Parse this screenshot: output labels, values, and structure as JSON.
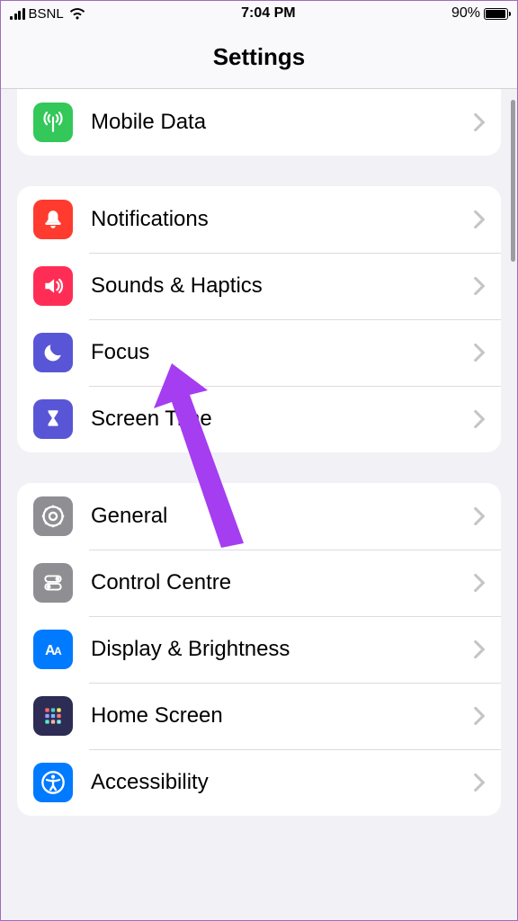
{
  "status": {
    "carrier": "BSNL",
    "time": "7:04 PM",
    "battery_pct": "90%",
    "battery_fill_pct": 90
  },
  "nav": {
    "title": "Settings"
  },
  "groups": [
    {
      "id": "connectivity",
      "rows": [
        {
          "id": "mobile-data",
          "label": "Mobile Data",
          "icon": "antenna-icon",
          "bg": "bg-green"
        }
      ]
    },
    {
      "id": "notifications",
      "rows": [
        {
          "id": "notifications",
          "label": "Notifications",
          "icon": "bell-icon",
          "bg": "bg-orange"
        },
        {
          "id": "sounds",
          "label": "Sounds & Haptics",
          "icon": "speaker-icon",
          "bg": "bg-red"
        },
        {
          "id": "focus",
          "label": "Focus",
          "icon": "moon-icon",
          "bg": "bg-indigo"
        },
        {
          "id": "screen-time",
          "label": "Screen Time",
          "icon": "hourglass-icon",
          "bg": "bg-indigo"
        }
      ]
    },
    {
      "id": "general",
      "rows": [
        {
          "id": "general",
          "label": "General",
          "icon": "gear-icon",
          "bg": "bg-gray"
        },
        {
          "id": "control-centre",
          "label": "Control Centre",
          "icon": "toggles-icon",
          "bg": "bg-gray"
        },
        {
          "id": "display",
          "label": "Display & Brightness",
          "icon": "aa-icon",
          "bg": "bg-blue"
        },
        {
          "id": "home-screen",
          "label": "Home Screen",
          "icon": "grid-icon",
          "bg": "bg-dark"
        },
        {
          "id": "accessibility",
          "label": "Accessibility",
          "icon": "accessibility-icon",
          "bg": "bg-blue"
        }
      ]
    }
  ],
  "annotation": {
    "arrow_color": "#a53df0"
  }
}
